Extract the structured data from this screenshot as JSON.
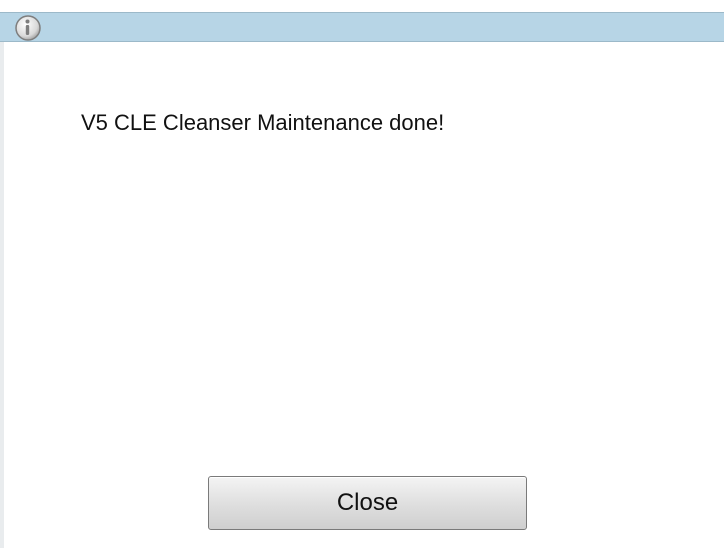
{
  "dialog": {
    "icon": "info-icon",
    "message": "V5 CLE Cleanser Maintenance done!",
    "close_label": "Close"
  },
  "colors": {
    "titlebar": "#b7d5e6",
    "background": "#ffffff",
    "button_border": "#7a7a7a"
  }
}
